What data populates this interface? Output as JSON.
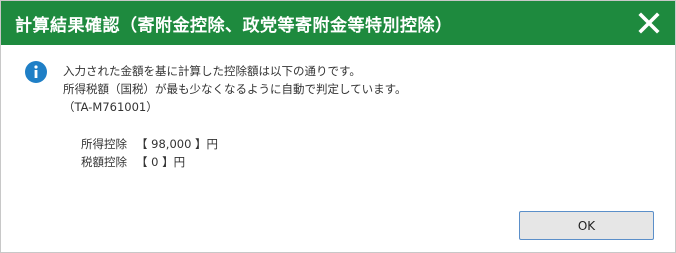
{
  "dialog": {
    "title": "計算結果確認（寄附金控除、政党等寄附金等特別控除）",
    "close_icon": "close-icon",
    "info_icon": "info-icon",
    "message": {
      "line1": "入力された金額を基に計算した控除額は以下の通りです。",
      "line2": "所得税額（国税）が最も少なくなるように自動で判定しています。",
      "code": "（TA-M761001）"
    },
    "results": [
      {
        "label": "所得控除",
        "value": "【 98,000 】円"
      },
      {
        "label": "税額控除",
        "value": "【 0 】円"
      }
    ],
    "ok_label": "OK"
  },
  "colors": {
    "titlebar": "#1e8a3e",
    "info": "#1f7fc6",
    "button_border": "#5b8fc9"
  }
}
